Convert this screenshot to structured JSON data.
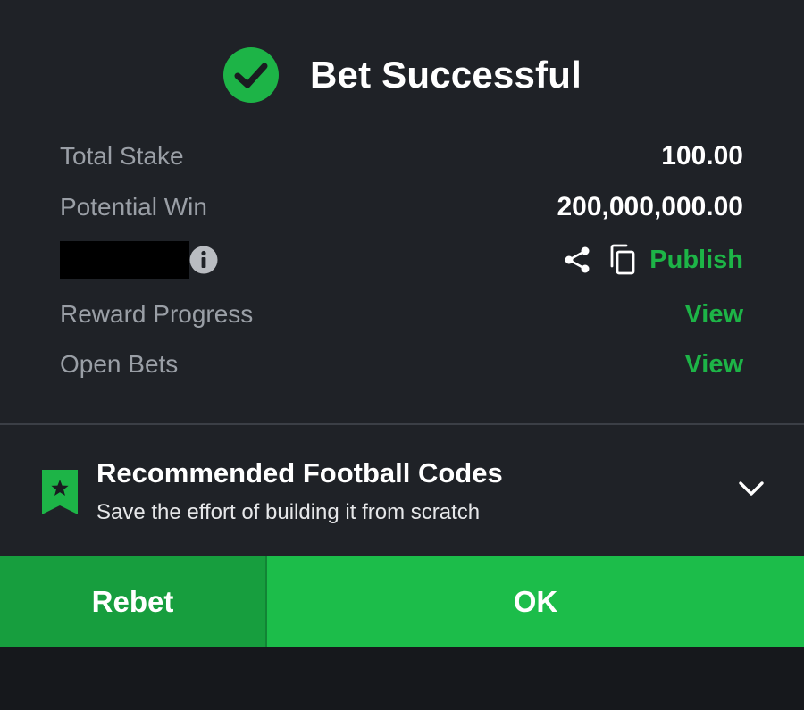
{
  "header": {
    "title": "Bet Successful",
    "check_icon": "check-circle-icon",
    "check_color": "#1db447"
  },
  "summary": {
    "total_stake_label": "Total Stake",
    "total_stake_value": "100.00",
    "potential_win_label": "Potential Win",
    "potential_win_value": "200,000,000.00",
    "booking_code_icon": "info-icon",
    "share_icon": "share-icon",
    "copy_icon": "copy-icon",
    "publish_label": "Publish",
    "reward_progress_label": "Reward Progress",
    "reward_progress_link": "View",
    "open_bets_label": "Open Bets",
    "open_bets_link": "View"
  },
  "recommended": {
    "title": "Recommended Football Codes",
    "subtitle": "Save the effort of building it from scratch",
    "bookmark_icon": "bookmark-star-icon",
    "chevron_icon": "chevron-down-icon"
  },
  "actions": {
    "rebet_label": "Rebet",
    "ok_label": "OK"
  },
  "colors": {
    "accent": "#1db447",
    "ok_button": "#1cbd4a",
    "rebet_button": "#179e3e",
    "background": "#1f2227"
  }
}
